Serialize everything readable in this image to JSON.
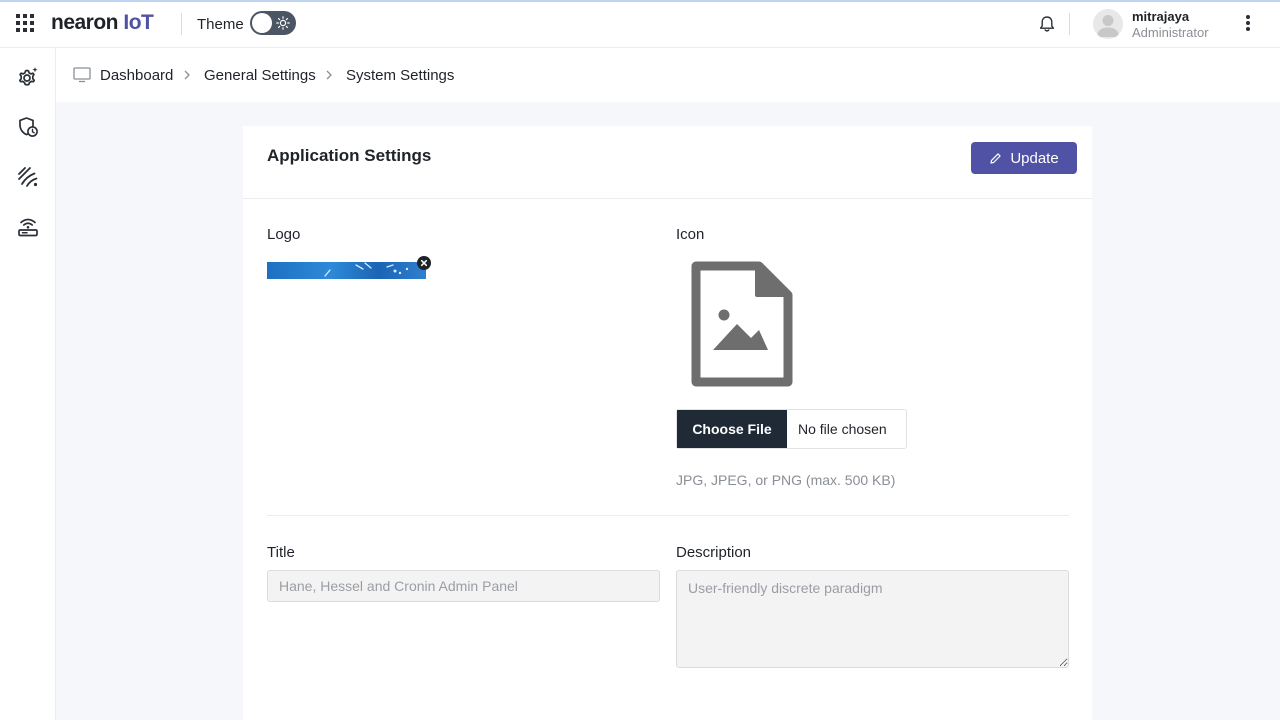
{
  "header": {
    "brand_main": "nearon",
    "brand_accent": "IoT",
    "theme_label": "Theme",
    "user_name": "mitrajaya",
    "user_role": "Administrator"
  },
  "sidebar": {
    "items": [
      {
        "icon": "settings-gear-icon"
      },
      {
        "icon": "shield-clock-icon"
      },
      {
        "icon": "signal-waves-icon"
      },
      {
        "icon": "router-wifi-icon"
      }
    ]
  },
  "breadcrumb": {
    "items": [
      "Dashboard",
      "General Settings",
      "System Settings"
    ]
  },
  "card": {
    "title": "Application Settings",
    "update_label": "Update",
    "logo_label": "Logo",
    "icon_label": "Icon",
    "choose_file_label": "Choose File",
    "file_status": "No file chosen",
    "file_hint": "JPG, JPEG, or PNG (max. 500 KB)",
    "title_label": "Title",
    "title_placeholder": "Hane, Hessel and Cronin Admin Panel",
    "description_label": "Description",
    "description_placeholder": "User-friendly discrete paradigm"
  },
  "colors": {
    "accent": "#4f52a5",
    "dark_button": "#1f2a36",
    "page_bg": "#f6f7fb"
  }
}
